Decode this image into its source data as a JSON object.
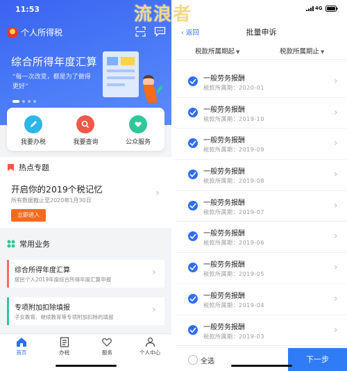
{
  "left": {
    "status_time": "11:53",
    "app_title": "个人所得税",
    "banner": {
      "title": "综合所得年度汇算",
      "subtitle": "“每一次改变，都是为了做得更好”"
    },
    "quick_actions": [
      {
        "label": "我要办税",
        "icon": "pen-icon",
        "color": "#2db6e8"
      },
      {
        "label": "我要查询",
        "icon": "search-icon",
        "color": "#f2574b"
      },
      {
        "label": "公众服务",
        "icon": "heart-hand-icon",
        "color": "#2fc79a"
      }
    ],
    "hot_topic": {
      "section_label": "热点专题",
      "title": "开启你的2019个税记忆",
      "subtitle": "所有数据截止至2020年1月30日",
      "button": "立即进入"
    },
    "common_business": {
      "section_label": "常用业务",
      "items": [
        {
          "title": "综合所得年度汇算",
          "subtitle": "居民个人2019年度综合所得年度汇算申报",
          "color": "#f36b6b"
        },
        {
          "title": "专项附加扣除填报",
          "subtitle": "子女教育、继续教育等专项附加扣除的填报",
          "color": "#2fc79a"
        }
      ]
    },
    "tabbar": [
      {
        "label": "首页",
        "icon": "home-icon",
        "active": true
      },
      {
        "label": "办税",
        "icon": "document-icon",
        "active": false
      },
      {
        "label": "服务",
        "icon": "heart-icon",
        "active": false
      },
      {
        "label": "个人中心",
        "icon": "user-icon",
        "active": false
      }
    ]
  },
  "right": {
    "status_network": "4G",
    "back_label": "返回",
    "title": "批量申诉",
    "filters": {
      "start": "税款所属期起",
      "end": "税款所属期止"
    },
    "rows": [
      {
        "title": "一般劳务报酬",
        "period": "税款所属期：2020-01",
        "checked": true
      },
      {
        "title": "一般劳务报酬",
        "period": "税款所属期：2019-10",
        "checked": true
      },
      {
        "title": "一般劳务报酬",
        "period": "税款所属期：2019-09",
        "checked": true
      },
      {
        "title": "一般劳务报酬",
        "period": "税款所属期：2019-08",
        "checked": true
      },
      {
        "title": "一般劳务报酬",
        "period": "税款所属期：2019-07",
        "checked": true
      },
      {
        "title": "一般劳务报酬",
        "period": "税款所属期：2019-06",
        "checked": true
      },
      {
        "title": "一般劳务报酬",
        "period": "税款所属期：2019-05",
        "checked": true
      },
      {
        "title": "一般劳务报酬",
        "period": "税款所属期：2019-04",
        "checked": true
      },
      {
        "title": "一般劳务报酬",
        "period": "税款所属期：2019-03",
        "checked": true
      }
    ],
    "select_all": "全选",
    "next_button": "下一步"
  },
  "watermark": "流浪者",
  "colors": {
    "accent": "#2f6df6",
    "orange": "#f36b1c"
  }
}
